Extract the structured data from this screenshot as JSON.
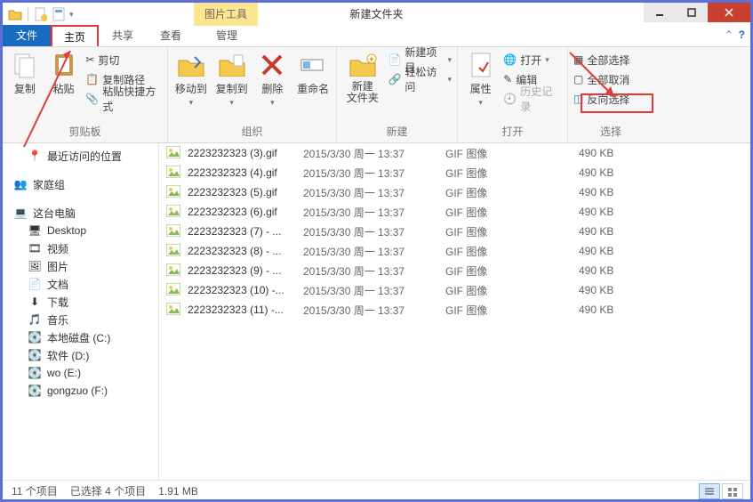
{
  "window": {
    "title": "新建文件夹",
    "tool_tab": "图片工具"
  },
  "tabs": {
    "file": "文件",
    "home": "主页",
    "share": "共享",
    "view": "查看",
    "manage": "管理"
  },
  "ribbon": {
    "clipboard": {
      "copy": "复制",
      "paste": "粘贴",
      "cut": "剪切",
      "copypath": "复制路径",
      "pasteshortcut": "粘贴快捷方式",
      "label": "剪贴板"
    },
    "organize": {
      "moveto": "移动到",
      "copyto": "复制到",
      "delete": "删除",
      "rename": "重命名",
      "label": "组织"
    },
    "new": {
      "newfolder": "新建\n文件夹",
      "newitem": "新建项目",
      "easyaccess": "轻松访问",
      "label": "新建"
    },
    "open": {
      "properties": "属性",
      "open": "打开",
      "edit": "编辑",
      "history": "历史记录",
      "label": "打开"
    },
    "select": {
      "selectall": "全部选择",
      "selectnone": "全部取消",
      "invert": "反向选择",
      "label": "选择"
    }
  },
  "nav": {
    "recent": "最近访问的位置",
    "homegroup": "家庭组",
    "thispc": "这台电脑",
    "desktop": "Desktop",
    "videos": "视频",
    "pictures": "图片",
    "documents": "文档",
    "downloads": "下载",
    "music": "音乐",
    "drive_c": "本地磁盘 (C:)",
    "drive_d": "软件 (D:)",
    "drive_e": "wo (E:)",
    "drive_f": "gongzuo (F:)"
  },
  "files": [
    {
      "name": "2223232323 (3).gif",
      "date": "2015/3/30 周一 13:37",
      "type": "GIF 图像",
      "size": "490 KB"
    },
    {
      "name": "2223232323 (4).gif",
      "date": "2015/3/30 周一 13:37",
      "type": "GIF 图像",
      "size": "490 KB"
    },
    {
      "name": "2223232323 (5).gif",
      "date": "2015/3/30 周一 13:37",
      "type": "GIF 图像",
      "size": "490 KB"
    },
    {
      "name": "2223232323 (6).gif",
      "date": "2015/3/30 周一 13:37",
      "type": "GIF 图像",
      "size": "490 KB"
    },
    {
      "name": "2223232323 (7) - ...",
      "date": "2015/3/30 周一 13:37",
      "type": "GIF 图像",
      "size": "490 KB"
    },
    {
      "name": "2223232323 (8) - ...",
      "date": "2015/3/30 周一 13:37",
      "type": "GIF 图像",
      "size": "490 KB"
    },
    {
      "name": "2223232323 (9) - ...",
      "date": "2015/3/30 周一 13:37",
      "type": "GIF 图像",
      "size": "490 KB"
    },
    {
      "name": "2223232323 (10) -...",
      "date": "2015/3/30 周一 13:37",
      "type": "GIF 图像",
      "size": "490 KB"
    },
    {
      "name": "2223232323 (11) -...",
      "date": "2015/3/30 周一 13:37",
      "type": "GIF 图像",
      "size": "490 KB"
    }
  ],
  "status": {
    "items": "11 个项目",
    "selected": "已选择 4 个项目",
    "size": "1.91 MB"
  }
}
